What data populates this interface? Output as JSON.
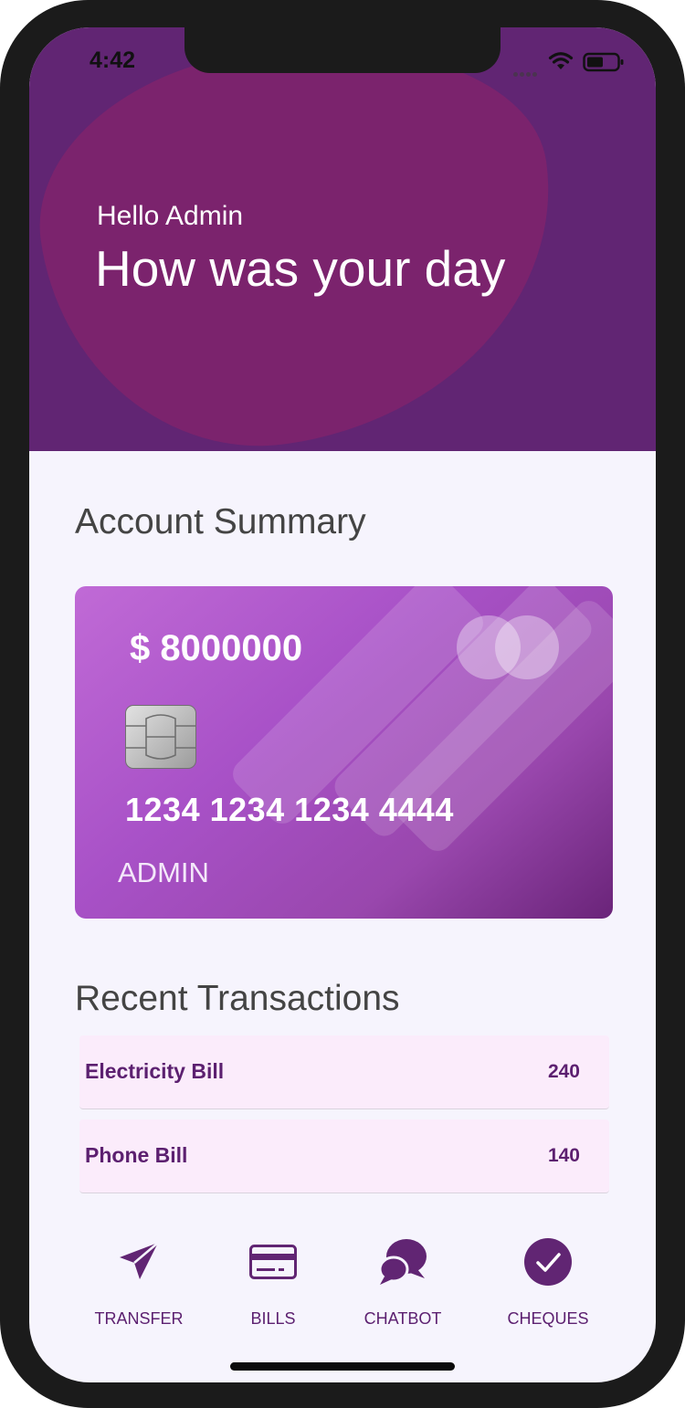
{
  "status_bar": {
    "time": "4:42"
  },
  "header": {
    "greeting": "Hello Admin",
    "subtitle": "How was your day"
  },
  "account_summary": {
    "title": "Account Summary",
    "card": {
      "balance": "$ 8000000",
      "number": "1234 1234 1234 4444",
      "holder": "ADMIN"
    }
  },
  "recent_transactions": {
    "title": "Recent Transactions",
    "items": [
      {
        "label": "Electricity Bill",
        "amount": "240"
      },
      {
        "label": "Phone Bill",
        "amount": "140"
      }
    ]
  },
  "nav": [
    {
      "label": "TRANSFER",
      "icon": "paper-plane-icon"
    },
    {
      "label": "BILLS",
      "icon": "credit-card-icon"
    },
    {
      "label": "CHATBOT",
      "icon": "chat-bubbles-icon"
    },
    {
      "label": "CHEQUES",
      "icon": "check-circle-icon"
    }
  ],
  "colors": {
    "primary": "#612573",
    "accent": "#7b236d",
    "card": "#a851c7",
    "background": "#f6f4fd"
  }
}
